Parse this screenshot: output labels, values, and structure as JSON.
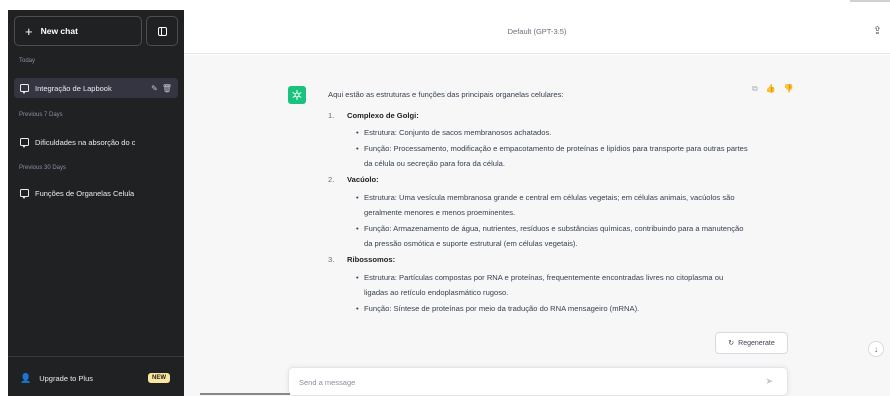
{
  "sidebar": {
    "new_chat_label": "New chat",
    "sections": [
      {
        "label": "Today",
        "items": [
          {
            "label": "Integração de Lapbook",
            "active": true
          }
        ]
      },
      {
        "label": "Previous 7 Days",
        "items": [
          {
            "label": "Dificuldades na absorção do c",
            "active": false
          }
        ]
      },
      {
        "label": "Previous 30 Days",
        "items": [
          {
            "label": "Funções de Organelas Celula",
            "active": false
          }
        ]
      }
    ],
    "upgrade_label": "Upgrade to Plus",
    "new_badge": "NEW"
  },
  "header": {
    "model": "Default (GPT-3.5)"
  },
  "message": {
    "intro": "Aqui estão as estruturas e funções das principais organelas celulares:",
    "organelles": [
      {
        "number": "1.",
        "title": "Complexo de Golgi",
        "bullets": [
          "Estrutura: Conjunto de sacos membranosos achatados.",
          "Função: Processamento, modificação e empacotamento de proteínas e lipídios para transporte para outras partes da célula ou secreção para fora da célula."
        ]
      },
      {
        "number": "2.",
        "title": "Vacúolo",
        "bullets": [
          "Estrutura: Uma vesícula membranosa grande e central em células vegetais; em células animais, vacúolos são geralmente menores e menos proeminentes.",
          "Função: Armazenamento de água, nutrientes, resíduos e substâncias químicas, contribuindo para a manutenção da pressão osmótica e suporte estrutural (em células vegetais)."
        ]
      },
      {
        "number": "3.",
        "title": "Ribossomos",
        "bullets": [
          "Estrutura: Partículas compostas por RNA e proteínas, frequentemente encontradas livres no citoplasma ou ligadas ao retículo endoplasmático rugoso.",
          "Função: Síntese de proteínas por meio da tradução do RNA mensageiro (mRNA)."
        ]
      }
    ]
  },
  "composer": {
    "placeholder": "Send a message",
    "regenerate_label": "Regenerate"
  },
  "colors": {
    "sidebar_bg": "#202123",
    "accent": "#19c37d",
    "badge": "#fae69e"
  }
}
